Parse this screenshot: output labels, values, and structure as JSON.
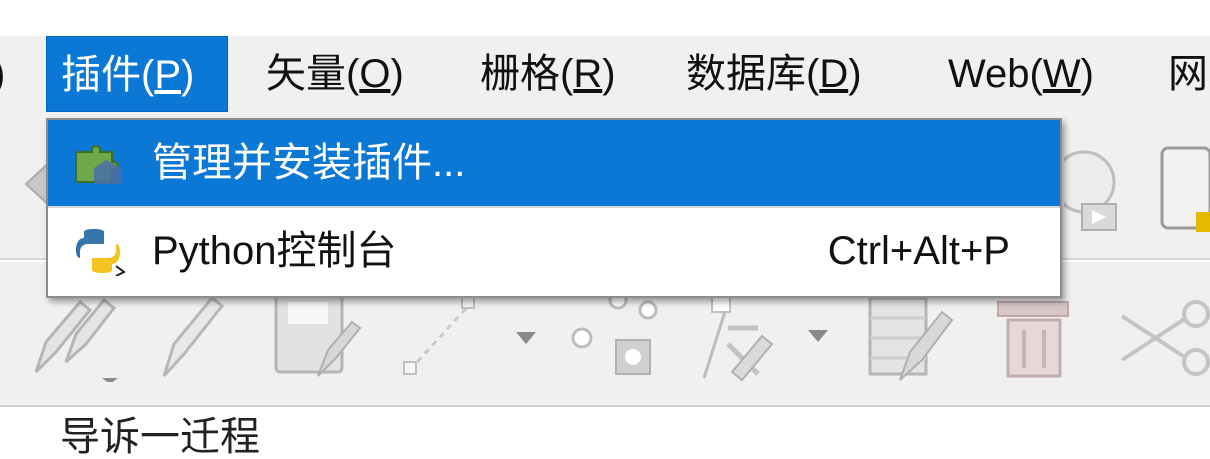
{
  "menubar": {
    "items": [
      {
        "label": ")",
        "mnemonic": ""
      },
      {
        "label": "插件(",
        "mnemonic": "P",
        "suffix": ")"
      },
      {
        "label": "矢量(",
        "mnemonic": "O",
        "suffix": ")"
      },
      {
        "label": "栅格(",
        "mnemonic": "R",
        "suffix": ")"
      },
      {
        "label": "数据库(",
        "mnemonic": "D",
        "suffix": ")"
      },
      {
        "label": "Web(",
        "mnemonic": "W",
        "suffix": ")"
      },
      {
        "label": "网",
        "mnemonic": ""
      }
    ]
  },
  "dropdown": {
    "items": [
      {
        "label": "管理并安装插件...",
        "shortcut": "",
        "icon": "plugin-puzzle-icon"
      },
      {
        "label": "Python控制台",
        "shortcut": "Ctrl+Alt+P",
        "icon": "python-icon"
      }
    ]
  },
  "bottom": {
    "text": "导诉一迁程"
  },
  "colors": {
    "accent": "#0a78d4",
    "menubar_bg": "#f0f0f0"
  }
}
